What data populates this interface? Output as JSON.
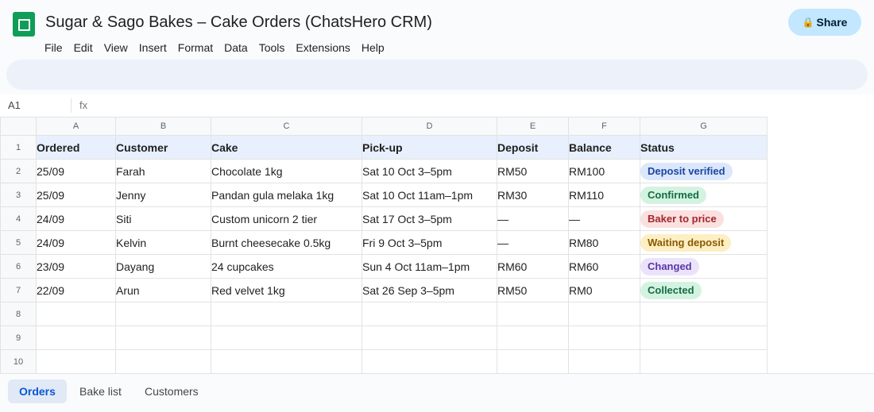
{
  "doc": {
    "title": "Sugar & Sago Bakes – Cake Orders (ChatsHero CRM)",
    "share_label": "Share",
    "share_icon": "lock-icon"
  },
  "menu": [
    "File",
    "Edit",
    "View",
    "Insert",
    "Format",
    "Data",
    "Tools",
    "Extensions",
    "Help"
  ],
  "formula_bar": {
    "cell_ref": "A1",
    "fx_label": "fx"
  },
  "grid": {
    "columns": [
      "A",
      "B",
      "C",
      "D",
      "E",
      "F",
      "G"
    ],
    "row_numbers": [
      "1",
      "2",
      "3",
      "4",
      "5",
      "6",
      "7",
      "8",
      "9",
      "10"
    ],
    "header": [
      "Ordered",
      "Customer",
      "Cake",
      "Pick-up",
      "Deposit",
      "Balance",
      "Status"
    ],
    "rows": [
      [
        "25/09",
        "Farah",
        "Chocolate 1kg",
        "Sat 10 Oct 3–5pm",
        "RM50",
        "RM100",
        "Deposit verified"
      ],
      [
        "25/09",
        "Jenny",
        "Pandan gula melaka 1kg",
        "Sat 10 Oct 11am–1pm",
        "RM30",
        "RM110",
        "Confirmed"
      ],
      [
        "24/09",
        "Siti",
        "Custom unicorn 2 tier",
        "Sat 17 Oct 3–5pm",
        "—",
        "—",
        "Baker to price"
      ],
      [
        "24/09",
        "Kelvin",
        "Burnt cheesecake 0.5kg",
        "Fri 9 Oct 3–5pm",
        "—",
        "RM80",
        "Waiting deposit"
      ],
      [
        "23/09",
        "Dayang",
        "24 cupcakes",
        "Sun 4 Oct 11am–1pm",
        "RM60",
        "RM60",
        "Changed"
      ],
      [
        "22/09",
        "Arun",
        "Red velvet 1kg",
        "Sat 26 Sep 3–5pm",
        "RM50",
        "RM0",
        "Collected"
      ]
    ],
    "empty_rows": 3
  },
  "status_colors": {
    "Deposit verified": {
      "bg": "#dbe7fb",
      "fg": "#1a46a3"
    },
    "Confirmed": {
      "bg": "#d3f3e0",
      "fg": "#146c43"
    },
    "Baker to price": {
      "bg": "#fbe0e0",
      "fg": "#a4262c"
    },
    "Waiting deposit": {
      "bg": "#fdefc3",
      "fg": "#8a5a00"
    },
    "Changed": {
      "bg": "#ebe3fb",
      "fg": "#5b35a8"
    },
    "Collected": {
      "bg": "#d3f3e0",
      "fg": "#146c43"
    }
  },
  "sheet_tabs": [
    {
      "label": "Orders",
      "active": true
    },
    {
      "label": "Bake list",
      "active": false
    },
    {
      "label": "Customers",
      "active": false
    }
  ]
}
